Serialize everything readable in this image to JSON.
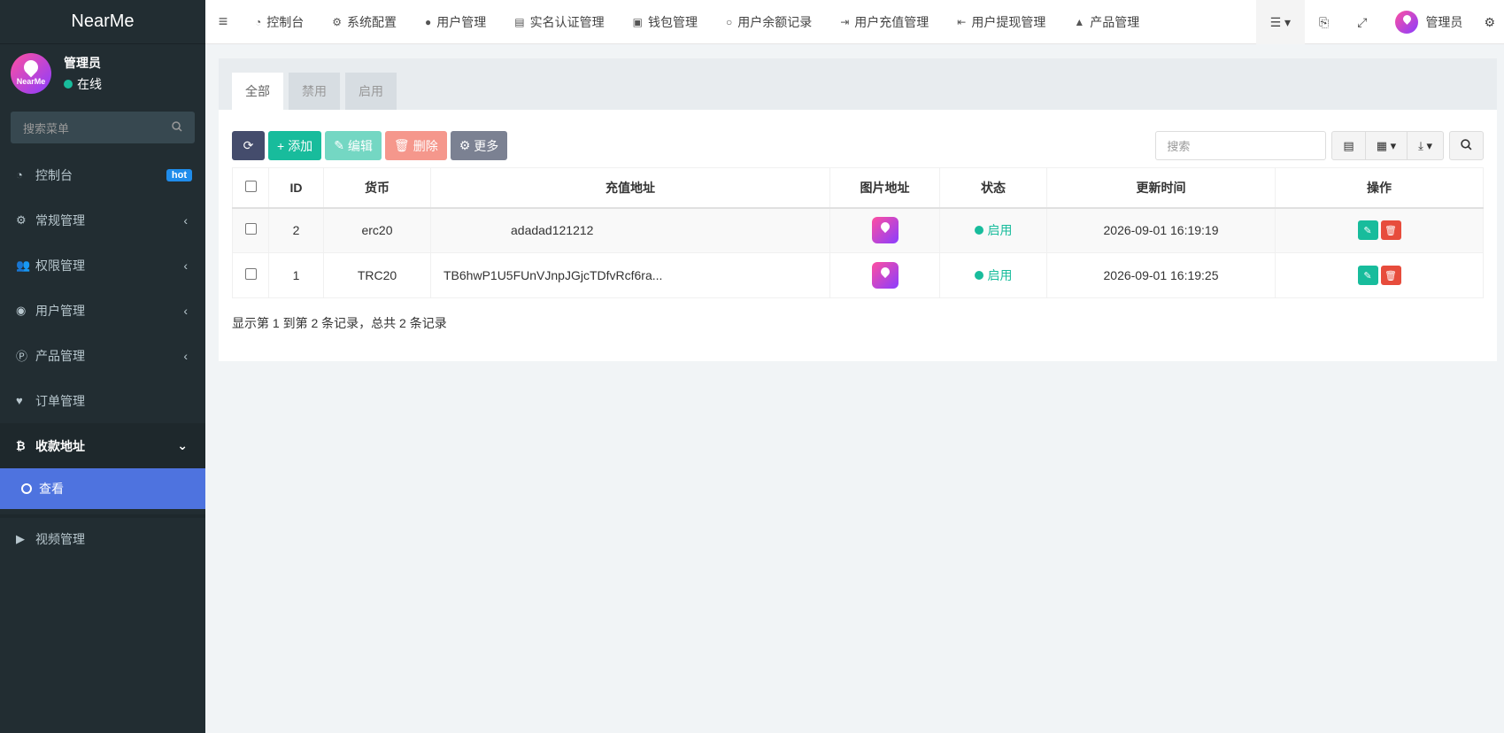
{
  "app": {
    "title": "NearMe"
  },
  "user": {
    "name": "管理员",
    "status": "在线",
    "avatar_text": "NearMe"
  },
  "sidebar": {
    "search_placeholder": "搜索菜单",
    "items": [
      {
        "label": "控制台",
        "icon": "dashboard-icon",
        "badge": "hot"
      },
      {
        "label": "常规管理",
        "icon": "cogs-icon"
      },
      {
        "label": "权限管理",
        "icon": "users-icon"
      },
      {
        "label": "用户管理",
        "icon": "user-circle-icon"
      },
      {
        "label": "产品管理",
        "icon": "product-icon"
      },
      {
        "label": "订单管理",
        "icon": "heartbeat-icon"
      },
      {
        "label": "收款地址",
        "icon": "bitcoin-icon"
      },
      {
        "label": "查看",
        "icon": "circle-o-icon"
      },
      {
        "label": "视频管理",
        "icon": "video-icon"
      }
    ]
  },
  "topnav": {
    "items": [
      {
        "label": "控制台"
      },
      {
        "label": "系统配置"
      },
      {
        "label": "用户管理"
      },
      {
        "label": "实名认证管理"
      },
      {
        "label": "钱包管理"
      },
      {
        "label": "用户余额记录"
      },
      {
        "label": "用户充值管理"
      },
      {
        "label": "用户提现管理"
      },
      {
        "label": "产品管理"
      }
    ],
    "admin_label": "管理员"
  },
  "tabs": [
    {
      "label": "全部"
    },
    {
      "label": "禁用"
    },
    {
      "label": "启用"
    }
  ],
  "toolbar": {
    "add": "添加",
    "edit": "编辑",
    "delete": "删除",
    "more": "更多",
    "search_placeholder": "搜索"
  },
  "table": {
    "headers": {
      "id": "ID",
      "currency": "货币",
      "address": "充值地址",
      "image": "图片地址",
      "status": "状态",
      "updated": "更新时间",
      "actions": "操作"
    },
    "rows": [
      {
        "id": "2",
        "currency": "erc20",
        "address": "adadad121212",
        "status": "启用",
        "updated": "2026-09-01 16:19:19"
      },
      {
        "id": "1",
        "currency": "TRC20",
        "address": "TB6hwP1U5FUnVJnpJGjcTDfvRcf6ra...",
        "status": "启用",
        "updated": "2026-09-01 16:19:25"
      }
    ]
  },
  "pager": {
    "summary": "显示第 1 到第 2 条记录，总共 2 条记录"
  },
  "colors": {
    "sidebar_bg": "#222d32",
    "active_blue": "#4e73df",
    "success": "#18bc9c",
    "danger": "#e74c3c"
  }
}
